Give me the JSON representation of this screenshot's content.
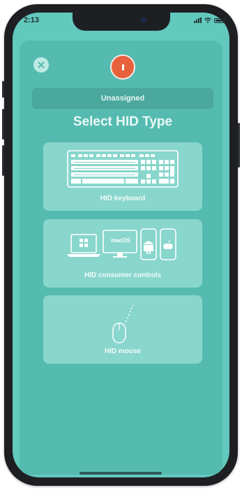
{
  "status_bar": {
    "time": "2:13"
  },
  "header": {
    "assignment_label": "Unassigned",
    "title": "Select HID Type"
  },
  "options": [
    {
      "label": "HID keyboard",
      "icon": "keyboard-icon"
    },
    {
      "label": "HID consumer controls",
      "icon": "devices-icon",
      "badge": "macOS"
    },
    {
      "label": "HID mouse",
      "icon": "mouse-icon"
    }
  ],
  "colors": {
    "background": "#63c8bd",
    "panel": "#55bbb0",
    "card": "#88d6cc",
    "record": "#e8613d"
  }
}
